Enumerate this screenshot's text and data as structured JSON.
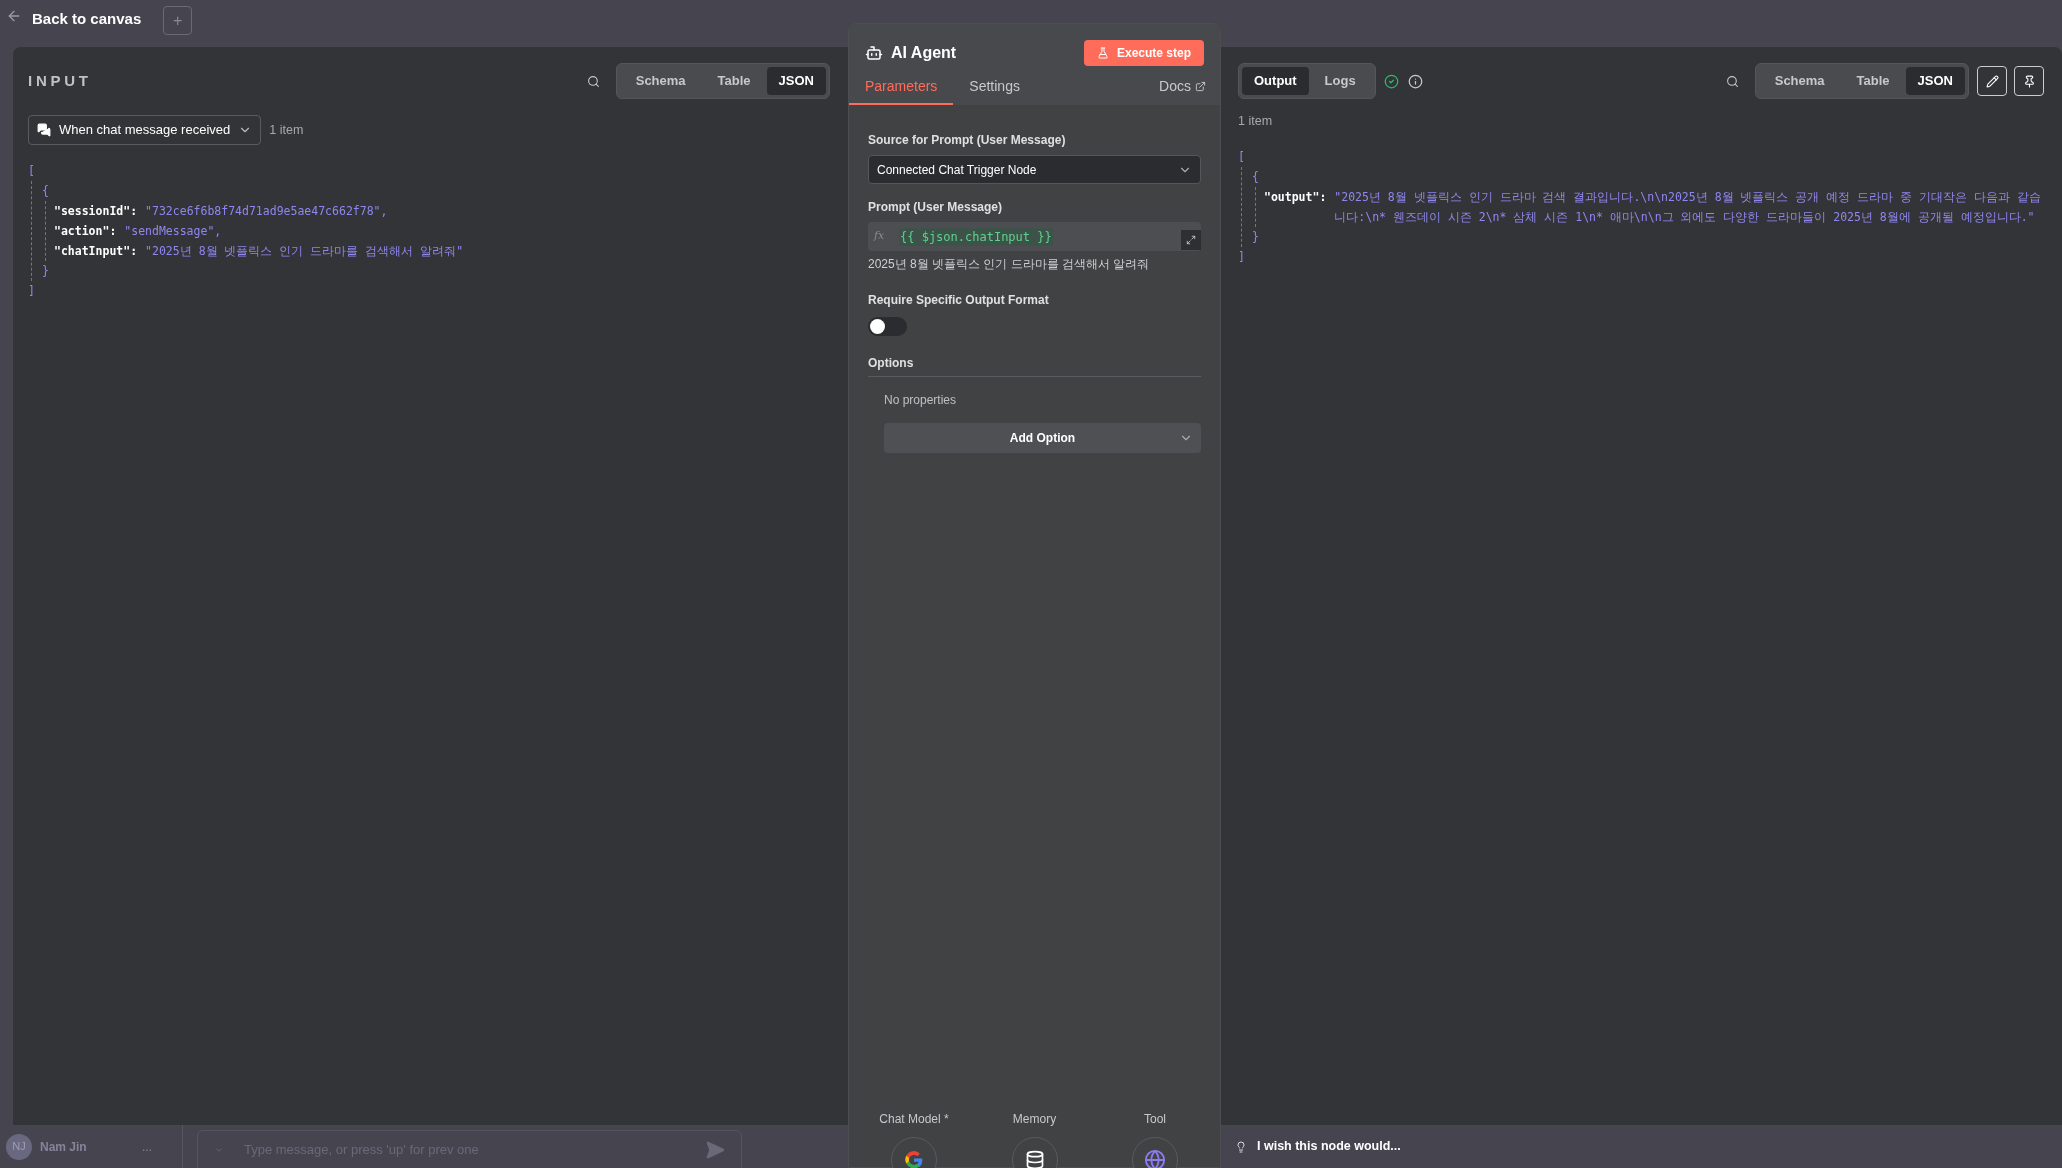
{
  "top_bar": {
    "back_label": "Back to canvas",
    "add_button": "+"
  },
  "input_panel": {
    "title": "INPUT",
    "view_tabs": [
      {
        "label": "Schema",
        "selected": false
      },
      {
        "label": "Table",
        "selected": false
      },
      {
        "label": "JSON",
        "selected": true
      }
    ],
    "source": "When chat message received",
    "item_count": "1 item",
    "json": {
      "open_bracket": "[",
      "open_brace": "{",
      "fields": [
        {
          "key": "\"sessionId\":",
          "value": "\"732ce6f6b8f74d71ad9e5ae47c662f78\","
        },
        {
          "key": "\"action\":",
          "value": "\"sendMessage\","
        },
        {
          "key": "\"chatInput\":",
          "value": "\"2025년 8월 넷플릭스 인기 드라마를 검색해서 알려줘\""
        }
      ],
      "close_brace": "}",
      "close_bracket": "]"
    }
  },
  "node_panel": {
    "title": "AI Agent",
    "execute_button": "Execute step",
    "tabs": [
      {
        "label": "Parameters",
        "selected": true
      },
      {
        "label": "Settings",
        "selected": false
      }
    ],
    "docs_link": "Docs",
    "source_label": "Source for Prompt (User Message)",
    "source_value": "Connected Chat Trigger Node",
    "prompt_label": "Prompt (User Message)",
    "fx": "fx",
    "prompt_expression": "{{ $json.chatInput }}",
    "prompt_preview": "2025년 8월 넷플릭스 인기 드라마를 검색해서 알려줘",
    "format_label": "Require Specific Output Format",
    "format_toggle": {
      "on": false
    },
    "options_label": "Options",
    "no_properties": "No properties",
    "add_option": "Add Option",
    "sub_nodes": [
      {
        "label": "Chat Model *",
        "kind": "google"
      },
      {
        "label": "Memory",
        "kind": "database"
      },
      {
        "label": "Tool",
        "kind": "globe"
      }
    ]
  },
  "output_panel": {
    "view_tabs": [
      {
        "label": "Output",
        "selected": true
      },
      {
        "label": "Logs",
        "selected": false
      }
    ],
    "data_tabs": [
      {
        "label": "Schema",
        "selected": false
      },
      {
        "label": "Table",
        "selected": false
      },
      {
        "label": "JSON",
        "selected": true
      }
    ],
    "item_count": "1 item",
    "json": {
      "open_bracket": "[",
      "open_brace": "{",
      "fields": [
        {
          "key": "\"output\":",
          "value": "\"2025년 8월 넷플릭스 인기 드라마 검색 결과입니다.\\n\\n2025년 8월 넷플릭스 공개 예정 드라마 중 기대작은 다음과 같습니다:\\n* 웬즈데이 시즌 2\\n* 삼체 시즌 1\\n* 애마\\n\\n그 외에도 다양한 드라마들이 2025년 8월에 공개될 예정입니다.\""
        }
      ],
      "close_brace": "}",
      "close_bracket": "]"
    },
    "feedback": "I wish this node would..."
  },
  "chat_bar": {
    "avatar": "NJ",
    "user_name": "Nam Jin",
    "more": "...",
    "placeholder": "Type message, or press 'up' for prev one"
  }
}
